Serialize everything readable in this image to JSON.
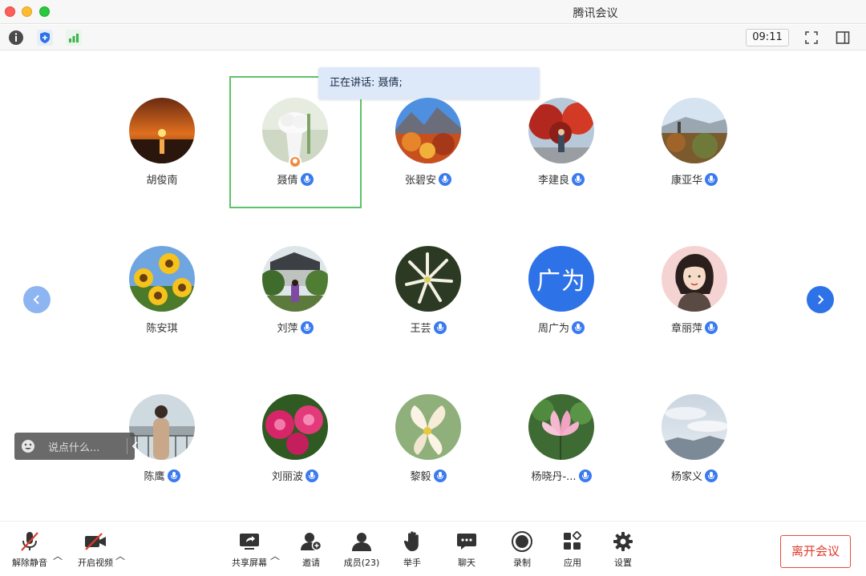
{
  "window": {
    "title": "腾讯会议"
  },
  "infobar": {
    "clock": "09:11"
  },
  "speaking": {
    "text": "正在讲话: 聂倩;"
  },
  "participants": [
    {
      "name": "胡俊南",
      "mic": false,
      "avatar": "sunset"
    },
    {
      "name": "聂倩",
      "mic": true,
      "avatar": "white-flower",
      "host": true
    },
    {
      "name": "张碧安",
      "mic": true,
      "avatar": "autumn-mountain"
    },
    {
      "name": "李建良",
      "mic": true,
      "avatar": "red-trees"
    },
    {
      "name": "康亚华",
      "mic": true,
      "avatar": "hill-hiker"
    },
    {
      "name": "陈安琪",
      "mic": false,
      "avatar": "sunflowers"
    },
    {
      "name": "刘萍",
      "mic": true,
      "avatar": "garden-person"
    },
    {
      "name": "王芸",
      "mic": true,
      "avatar": "lily"
    },
    {
      "name": "周广为",
      "mic": true,
      "avatar": "text",
      "avatar_text": "广为"
    },
    {
      "name": "章丽萍",
      "mic": true,
      "avatar": "cartoon-woman"
    },
    {
      "name": "陈鹰",
      "mic": true,
      "avatar": "lake-person"
    },
    {
      "name": "刘丽波",
      "mic": true,
      "avatar": "peony"
    },
    {
      "name": "黎毅",
      "mic": true,
      "avatar": "white-lotus"
    },
    {
      "name": "杨晓丹-...",
      "mic": true,
      "avatar": "pink-lotus"
    },
    {
      "name": "杨家义",
      "mic": true,
      "avatar": "cloudy-sky"
    }
  ],
  "chat": {
    "placeholder": "说点什么..."
  },
  "toolbar": {
    "unmute": "解除静音",
    "video": "开启视频",
    "share": "共享屏幕",
    "invite": "邀请",
    "members": "成员(23)",
    "raise_hand": "举手",
    "chat": "聊天",
    "record": "录制",
    "apps": "应用",
    "settings": "设置",
    "leave": "离开会议"
  },
  "colors": {
    "accent": "#2e72e8",
    "speaking": "#5ec26a",
    "leave": "#e03a2b"
  }
}
